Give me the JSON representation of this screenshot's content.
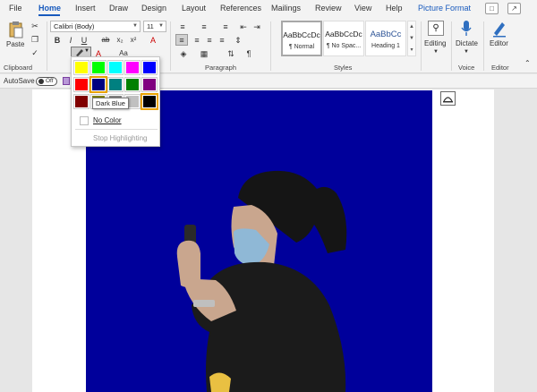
{
  "tabs": [
    "File",
    "Home",
    "Insert",
    "Draw",
    "Design",
    "Layout",
    "References",
    "Mailings",
    "Review",
    "View",
    "Help",
    "Picture Format"
  ],
  "active_tab": "Home",
  "clipboard": {
    "paste_label": "Paste",
    "group_label": "Clipboard"
  },
  "font": {
    "name": "Calibri (Body)",
    "size": "11",
    "bold": "B",
    "italic": "I",
    "underline": "U",
    "strike": "ab",
    "subscript": "x₂",
    "superscript": "x²",
    "font_color_letter": "A",
    "case_label": "Aa"
  },
  "paragraph": {
    "group_label": "Paragraph",
    "pilcrow": "¶"
  },
  "styles": {
    "group_label": "Styles",
    "items": [
      {
        "preview": "AaBbCcDc",
        "name": "¶ Normal"
      },
      {
        "preview": "AaBbCcDc",
        "name": "¶ No Spac..."
      },
      {
        "preview": "AaBbCc",
        "name": "Heading 1"
      }
    ]
  },
  "editing": {
    "label": "Editing"
  },
  "voice": {
    "dictate_label": "Dictate",
    "group_label": "Voice"
  },
  "editor": {
    "label": "Editor",
    "group_label": "Editor"
  },
  "autosave": {
    "label": "AutoSave",
    "state": "Off"
  },
  "highlight_menu": {
    "colors": [
      {
        "name": "Yellow",
        "hex": "#ffff00"
      },
      {
        "name": "Bright Green",
        "hex": "#00ff00"
      },
      {
        "name": "Turquoise",
        "hex": "#00ffff"
      },
      {
        "name": "Pink",
        "hex": "#ff00ff"
      },
      {
        "name": "Blue",
        "hex": "#0000ff"
      },
      {
        "name": "Red",
        "hex": "#ff0000"
      },
      {
        "name": "Dark Blue",
        "hex": "#000080"
      },
      {
        "name": "Teal",
        "hex": "#008080"
      },
      {
        "name": "Green",
        "hex": "#008000"
      },
      {
        "name": "Violet",
        "hex": "#800080"
      },
      {
        "name": "Dark Red",
        "hex": "#800000"
      },
      {
        "name": "Dark Yellow",
        "hex": "#808000"
      },
      {
        "name": "Gray 50%",
        "hex": "#808080"
      },
      {
        "name": "Gray 25%",
        "hex": "#c0c0c0"
      },
      {
        "name": "Black",
        "hex": "#000000"
      }
    ],
    "hovered": "Dark Blue",
    "tooltip": "Dark Blue",
    "no_color_label": "No Color",
    "stop_label": "Stop Highlighting"
  },
  "colors": {
    "accent": "#185abd",
    "image_background": "#00009b"
  }
}
